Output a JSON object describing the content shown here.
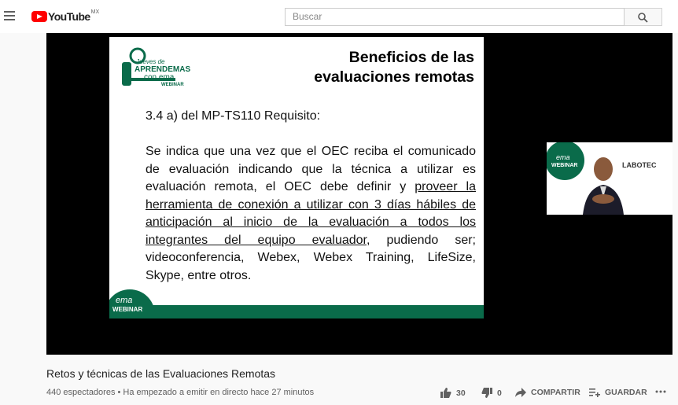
{
  "header": {
    "logo_text": "YouTube",
    "country_code": "MX",
    "search_placeholder": "Buscar"
  },
  "slide": {
    "logo_lines": [
      "Jueves de",
      "APRENDEMAS",
      "con ema",
      "WEBINAR"
    ],
    "title_line1": "Beneficios de las",
    "title_line2": "evaluaciones remotas",
    "requirement": "3.4 a) del MP-TS110 Requisito:",
    "body_plain1": "Se indica que una vez que el OEC reciba el comunicado de evaluación indicando que la técnica a utilizar es evaluación remota, el OEC debe definir y ",
    "body_underlined": "proveer la herramienta de conexión a utilizar con 3 días hábiles de anticipación al inicio de la evaluación a todos los integrantes del equipo evaluador",
    "body_plain2": ", pudiendo ser; videoconferencia, Webex, Webex Training, LifeSize, Skype, entre otros.",
    "badge_ema": "ema",
    "badge_webinar": "WEBINAR"
  },
  "camera": {
    "badge_ema": "ema",
    "badge_webinar": "WEBINAR",
    "company": "LABOTEC"
  },
  "video": {
    "title": "Retos y técnicas de las Evaluaciones Remotas",
    "meta": "440 espectadores • Ha empezado a emitir en directo hace 27 minutos",
    "likes": "30",
    "dislikes": "0",
    "share_label": "COMPARTIR",
    "save_label": "GUARDAR"
  },
  "colors": {
    "brand_red": "#ff0000",
    "slide_green": "#0a6b4a"
  }
}
